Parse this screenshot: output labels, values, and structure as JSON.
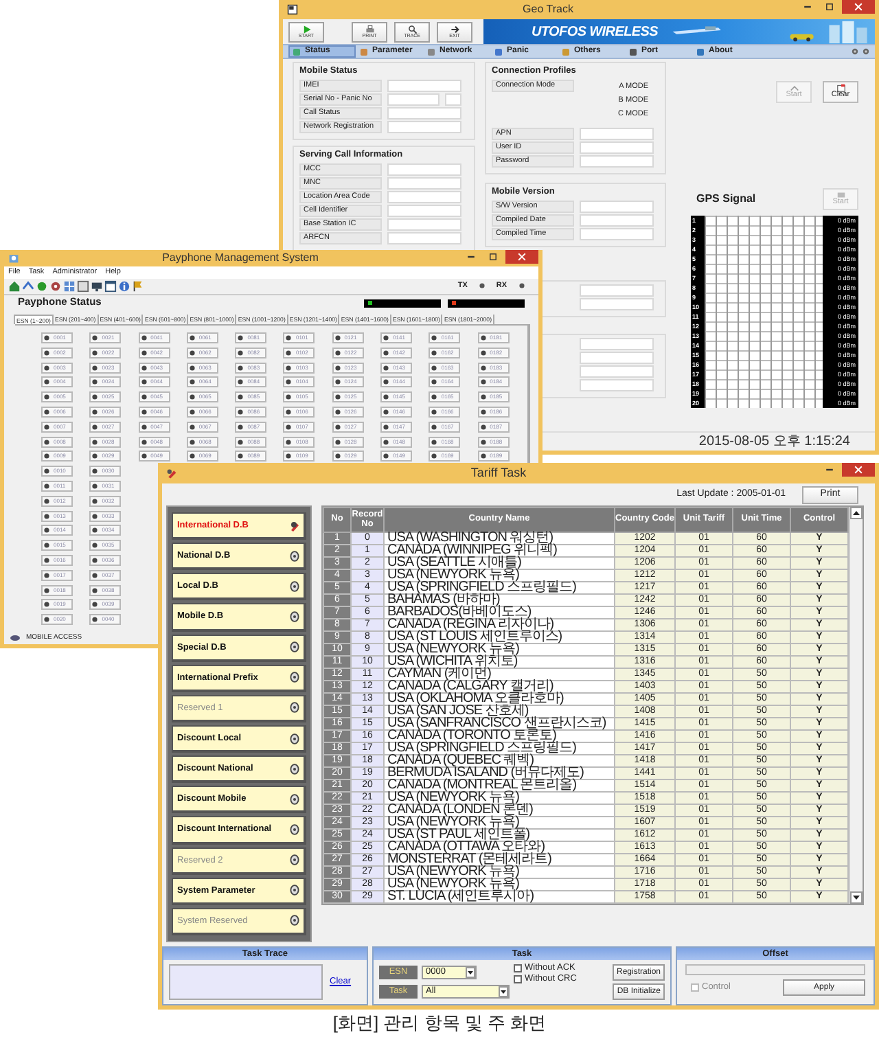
{
  "geo_track": {
    "title": "Geo Track",
    "toolbar": [
      {
        "kind": "start",
        "label": "START"
      },
      {
        "kind": "print",
        "label": "PRINT"
      },
      {
        "kind": "trace",
        "label": "TRACE"
      },
      {
        "kind": "exit",
        "label": "EXIT"
      }
    ],
    "banner": "UTOFOS WIRELESS",
    "tabs": [
      {
        "label": "Status",
        "selected": true
      },
      {
        "label": "Parameter",
        "selected": false
      },
      {
        "label": "Network",
        "selected": false
      },
      {
        "label": "Panic",
        "selected": false
      },
      {
        "label": "Others",
        "selected": false
      },
      {
        "label": "Port",
        "selected": false
      },
      {
        "label": "About",
        "selected": false
      }
    ],
    "mobile_status": {
      "title": "Mobile Status",
      "rows": [
        {
          "label": "IMEI",
          "kind": "single"
        },
        {
          "label": "Serial No - Panic No",
          "kind": "double"
        },
        {
          "label": "Call Status",
          "kind": "single"
        },
        {
          "label": "Network Registration",
          "kind": "single"
        }
      ]
    },
    "serving_cell": {
      "title": "Serving Call Information",
      "rows": [
        {
          "label": "MCC",
          "kind": "single"
        },
        {
          "label": "MNC",
          "kind": "single"
        },
        {
          "label": "Location Area Code",
          "kind": "single"
        },
        {
          "label": "Cell Identifier",
          "kind": "single"
        },
        {
          "label": "Base Station IC",
          "kind": "single"
        },
        {
          "label": "ARFCN",
          "kind": "single"
        }
      ]
    },
    "connection_profiles": {
      "title": "Connection Profiles",
      "mode_label": "Connection Mode",
      "modes": [
        "A MODE",
        "B MODE",
        "C MODE"
      ],
      "rows": [
        "APN",
        "User ID",
        "Password"
      ]
    },
    "mobile_version": {
      "title": "Mobile Version",
      "rows": [
        "S/W Version",
        "Compiled Date",
        "Compiled Time"
      ]
    },
    "start_button": {
      "label": "Start",
      "disabled": true
    },
    "clear_button": {
      "label": "Clear",
      "disabled": false
    },
    "gps": {
      "title": "GPS Signal",
      "start_button": {
        "label": "Start",
        "disabled": true
      },
      "channels": [
        {
          "no": "1",
          "reading": "0 dBm"
        },
        {
          "no": "2",
          "reading": "0 dBm"
        },
        {
          "no": "3",
          "reading": "0 dBm"
        },
        {
          "no": "4",
          "reading": "0 dBm"
        },
        {
          "no": "5",
          "reading": "0 dBm"
        },
        {
          "no": "6",
          "reading": "0 dBm"
        },
        {
          "no": "7",
          "reading": "0 dBm"
        },
        {
          "no": "8",
          "reading": "0 dBm"
        },
        {
          "no": "9",
          "reading": "0 dBm"
        },
        {
          "no": "10",
          "reading": "0 dBm"
        },
        {
          "no": "11",
          "reading": "0 dBm"
        },
        {
          "no": "12",
          "reading": "0 dBm"
        },
        {
          "no": "13",
          "reading": "0 dBm"
        },
        {
          "no": "14",
          "reading": "0 dBm"
        },
        {
          "no": "15",
          "reading": "0 dBm"
        },
        {
          "no": "16",
          "reading": "0 dBm"
        },
        {
          "no": "17",
          "reading": "0 dBm"
        },
        {
          "no": "18",
          "reading": "0 dBm"
        },
        {
          "no": "19",
          "reading": "0 dBm"
        },
        {
          "no": "20",
          "reading": "0 dBm"
        }
      ]
    },
    "status_time": "2015-08-05 오후 1:15:24"
  },
  "payphone": {
    "title": "Payphone Management System",
    "menu": [
      "File",
      "Task",
      "Administrator",
      "Help"
    ],
    "tx": "TX",
    "rx": "RX",
    "heading": "Payphone Status",
    "indicators": [
      {
        "color": "#22c022"
      },
      {
        "color": "#e03a1a"
      }
    ],
    "tabs": [
      {
        "label": "ESN (1~200)",
        "selected": true
      },
      {
        "label": "ESN (201~400)",
        "selected": false
      },
      {
        "label": "ESN (401~600)",
        "selected": false
      },
      {
        "label": "ESN (601~800)",
        "selected": false
      },
      {
        "label": "ESN (801~1000)",
        "selected": false
      },
      {
        "label": "ESN (1001~1200)",
        "selected": false
      },
      {
        "label": "ESN (1201~1400)",
        "selected": false
      },
      {
        "label": "ESN (1401~1600)",
        "selected": false
      },
      {
        "label": "ESN (1601~1800)",
        "selected": false
      },
      {
        "label": "ESN (1801~2000)",
        "selected": false
      }
    ],
    "esn_rows": [
      [
        "0001",
        "0021",
        "0041",
        "0061",
        "0081",
        "0101",
        "0121",
        "0141",
        "0161",
        "0181"
      ],
      [
        "0002",
        "0022",
        "0042",
        "0062",
        "0082",
        "0102",
        "0122",
        "0142",
        "0162",
        "0182"
      ],
      [
        "0003",
        "0023",
        "0043",
        "0063",
        "0083",
        "0103",
        "0123",
        "0143",
        "0163",
        "0183"
      ],
      [
        "0004",
        "0024",
        "0044",
        "0064",
        "0084",
        "0104",
        "0124",
        "0144",
        "0164",
        "0184"
      ],
      [
        "0005",
        "0025",
        "0045",
        "0065",
        "0085",
        "0105",
        "0125",
        "0145",
        "0165",
        "0185"
      ],
      [
        "0006",
        "0026",
        "0046",
        "0066",
        "0086",
        "0106",
        "0126",
        "0146",
        "0166",
        "0186"
      ],
      [
        "0007",
        "0027",
        "0047",
        "0067",
        "0087",
        "0107",
        "0127",
        "0147",
        "0167",
        "0187"
      ],
      [
        "0008",
        "0028",
        "0048",
        "0068",
        "0088",
        "0108",
        "0128",
        "0148",
        "0168",
        "0188"
      ],
      [
        "0009",
        "0029",
        "0049",
        "0069",
        "0089",
        "0109",
        "0129",
        "0149",
        "0169",
        "0189"
      ],
      [
        "0010",
        "0030"
      ],
      [
        "0011",
        "0031"
      ],
      [
        "0012",
        "0032"
      ],
      [
        "0013",
        "0033"
      ],
      [
        "0014",
        "0034"
      ],
      [
        "0015",
        "0035"
      ],
      [
        "0016",
        "0036"
      ],
      [
        "0017",
        "0037"
      ],
      [
        "0018",
        "0038"
      ],
      [
        "0019",
        "0039"
      ],
      [
        "0020",
        "0040"
      ]
    ],
    "status": "MOBILE ACCESS"
  },
  "tariff": {
    "title": "Tariff Task",
    "last_update": "Last Update : 2005-01-01",
    "print": "Print",
    "menu": [
      {
        "label": "International D.B",
        "selected": true,
        "disabled": false
      },
      {
        "label": "National D.B",
        "selected": false,
        "disabled": false
      },
      {
        "label": "Local D.B",
        "selected": false,
        "disabled": false
      },
      {
        "label": "Mobile D.B",
        "selected": false,
        "disabled": false
      },
      {
        "label": "Special D.B",
        "selected": false,
        "disabled": false
      },
      {
        "label": "International Prefix",
        "selected": false,
        "disabled": false
      },
      {
        "label": "Reserved 1",
        "selected": false,
        "disabled": true
      },
      {
        "label": "Discount Local",
        "selected": false,
        "disabled": false
      },
      {
        "label": "Discount National",
        "selected": false,
        "disabled": false
      },
      {
        "label": "Discount Mobile",
        "selected": false,
        "disabled": false
      },
      {
        "label": "Discount International",
        "selected": false,
        "disabled": false
      },
      {
        "label": "Reserved 2",
        "selected": false,
        "disabled": true
      },
      {
        "label": "System Parameter",
        "selected": false,
        "disabled": false
      },
      {
        "label": "System Reserved",
        "selected": false,
        "disabled": true
      }
    ],
    "columns": [
      "No",
      "Record No",
      "Country Name",
      "Country Code",
      "Unit Tariff",
      "Unit Time",
      "Control"
    ],
    "rows": [
      [
        "1",
        "0",
        "USA (WASHINGTON 워싱턴)",
        "1202",
        "01",
        "60",
        "Y"
      ],
      [
        "2",
        "1",
        "CANADA (WINNIPEG 위니펙)",
        "1204",
        "01",
        "60",
        "Y"
      ],
      [
        "3",
        "2",
        "USA (SEATTLE 시애틀)",
        "1206",
        "01",
        "60",
        "Y"
      ],
      [
        "4",
        "3",
        "USA (NEWYORK 뉴욕)",
        "1212",
        "01",
        "60",
        "Y"
      ],
      [
        "5",
        "4",
        "USA (SPRINGFIELD 스프링필드)",
        "1217",
        "01",
        "60",
        "Y"
      ],
      [
        "6",
        "5",
        "BAHAMAS (바하마)",
        "1242",
        "01",
        "60",
        "Y"
      ],
      [
        "7",
        "6",
        "BARBADOS(바베이도스)",
        "1246",
        "01",
        "60",
        "Y"
      ],
      [
        "8",
        "7",
        "CANADA (REGINA 리자이나)",
        "1306",
        "01",
        "60",
        "Y"
      ],
      [
        "9",
        "8",
        "USA (ST LOUIS 세인트루이스)",
        "1314",
        "01",
        "60",
        "Y"
      ],
      [
        "10",
        "9",
        "USA (NEWYORK 뉴욕)",
        "1315",
        "01",
        "60",
        "Y"
      ],
      [
        "11",
        "10",
        "USA (WICHITA 위치토)",
        "1316",
        "01",
        "60",
        "Y"
      ],
      [
        "12",
        "11",
        "CAYMAN (케이먼)",
        "1345",
        "01",
        "50",
        "Y"
      ],
      [
        "13",
        "12",
        "CANADA (CALGARY 캘거리)",
        "1403",
        "01",
        "50",
        "Y"
      ],
      [
        "14",
        "13",
        "USA (OKLAHOMA 오클라호마)",
        "1405",
        "01",
        "50",
        "Y"
      ],
      [
        "15",
        "14",
        "USA (SAN JOSE 산호세)",
        "1408",
        "01",
        "50",
        "Y"
      ],
      [
        "16",
        "15",
        "USA (SANFRANCISCO 샌프란시스코)",
        "1415",
        "01",
        "50",
        "Y"
      ],
      [
        "17",
        "16",
        "CANADA (TORONTO 토론토)",
        "1416",
        "01",
        "50",
        "Y"
      ],
      [
        "18",
        "17",
        "USA (SPRINGFIELD 스프링필드)",
        "1417",
        "01",
        "50",
        "Y"
      ],
      [
        "19",
        "18",
        "CANADA (QUEBEC 퀘벡)",
        "1418",
        "01",
        "50",
        "Y"
      ],
      [
        "20",
        "19",
        "BERMUDA ISALAND (버뮤다제도)",
        "1441",
        "01",
        "50",
        "Y"
      ],
      [
        "21",
        "20",
        "CANADA (MONTREAL 몬트리올)",
        "1514",
        "01",
        "50",
        "Y"
      ],
      [
        "22",
        "21",
        "USA (NEWYORK 뉴욕)",
        "1518",
        "01",
        "50",
        "Y"
      ],
      [
        "23",
        "22",
        "CANADA (LONDEN 론덴)",
        "1519",
        "01",
        "50",
        "Y"
      ],
      [
        "24",
        "23",
        "USA (NEWYORK 뉴욕)",
        "1607",
        "01",
        "50",
        "Y"
      ],
      [
        "25",
        "24",
        "USA (ST PAUL 세인트폴)",
        "1612",
        "01",
        "50",
        "Y"
      ],
      [
        "26",
        "25",
        "CANADA (OTTAWA 오타와)",
        "1613",
        "01",
        "50",
        "Y"
      ],
      [
        "27",
        "26",
        "MONSTERRAT (몬테세라트)",
        "1664",
        "01",
        "50",
        "Y"
      ],
      [
        "28",
        "27",
        "USA (NEWYORK 뉴욕)",
        "1716",
        "01",
        "50",
        "Y"
      ],
      [
        "29",
        "28",
        "USA (NEWYORK 뉴욕)",
        "1718",
        "01",
        "50",
        "Y"
      ],
      [
        "30",
        "29",
        "ST. LUCIA (세인트루시아)",
        "1758",
        "01",
        "50",
        "Y"
      ]
    ],
    "task_trace": {
      "title": "Task Trace",
      "clear": "Clear"
    },
    "task": {
      "title": "Task",
      "esn_label": "ESN",
      "esn_value": "0000",
      "task_label": "Task",
      "task_value": "All",
      "options": [
        {
          "label": "Without ACK",
          "checked": false
        },
        {
          "label": "Without CRC",
          "checked": false
        }
      ],
      "buttons": [
        "Registration",
        "DB Initialize"
      ]
    },
    "offset": {
      "title": "Offset",
      "control": {
        "label": "Control",
        "checked": false,
        "disabled": true
      },
      "apply": "Apply"
    }
  },
  "caption": "[화면] 관리 항목 및 주 화면"
}
